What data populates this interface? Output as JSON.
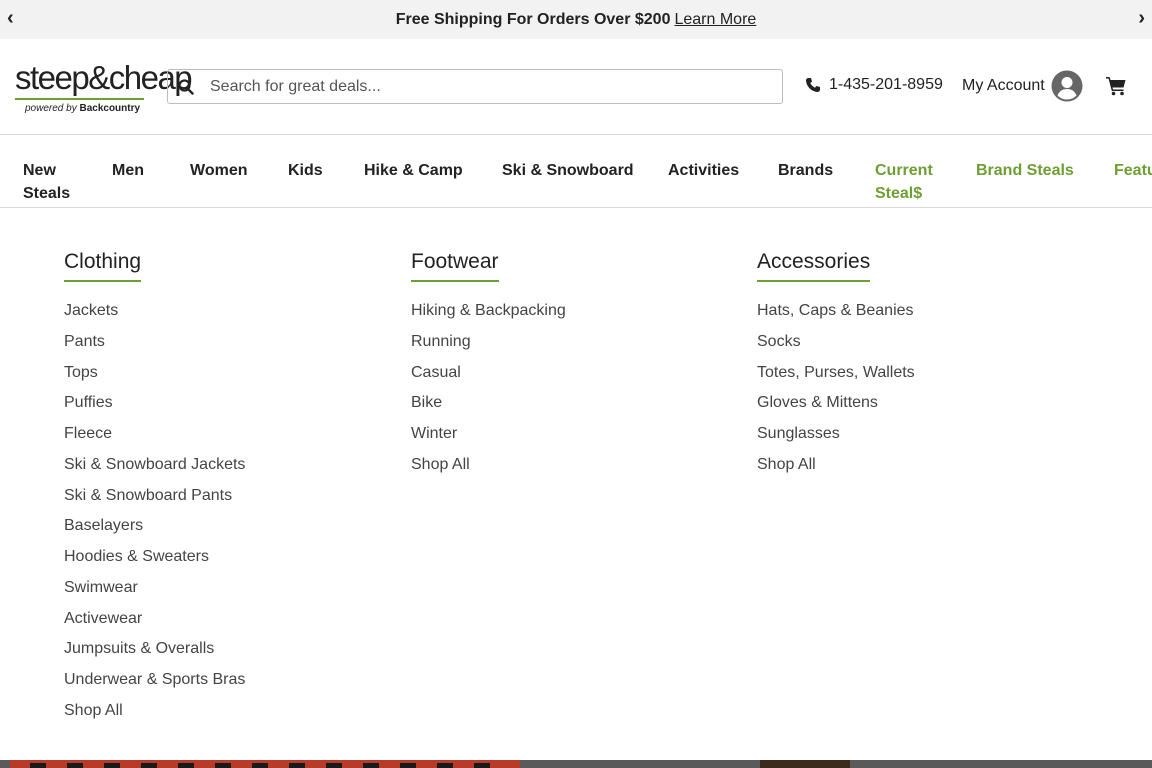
{
  "promo": {
    "text": "Free Shipping For Orders Over $200",
    "link": "Learn More"
  },
  "logo": {
    "wordmark": "steep&cheap",
    "powered": "powered by",
    "brand": "Backcountry"
  },
  "search": {
    "placeholder": "Search for great deals..."
  },
  "phone": "1-435-201-8959",
  "account_label": "My Account",
  "nav": [
    "New\nSteals",
    "Men",
    "Women",
    "Kids",
    "Hike & Camp",
    "Ski & Snowboard",
    "Activities",
    "Brands",
    "Current\nSteal$",
    "Brand Steals",
    "Featu"
  ],
  "menu": {
    "columns": [
      {
        "heading": "Clothing",
        "items": [
          "Jackets",
          "Pants",
          "Tops",
          "Puffies",
          "Fleece",
          "Ski & Snowboard Jackets",
          "Ski & Snowboard Pants",
          "Baselayers",
          "Hoodies & Sweaters",
          "Swimwear",
          "Activewear",
          "Jumpsuits & Overalls",
          "Underwear & Sports Bras",
          "Shop All"
        ]
      },
      {
        "heading": "Footwear",
        "items": [
          "Hiking & Backpacking",
          "Running",
          "Casual",
          "Bike",
          "Winter",
          "Shop All"
        ]
      },
      {
        "heading": "Accessories",
        "items": [
          "Hats, Caps & Beanies",
          "Socks",
          "Totes, Purses, Wallets",
          "Gloves & Mittens",
          "Sunglasses",
          "Shop All"
        ]
      }
    ]
  },
  "colors": {
    "accent": "#6d9f33",
    "text": "#222222",
    "promo_bg": "#f2f2f2"
  }
}
